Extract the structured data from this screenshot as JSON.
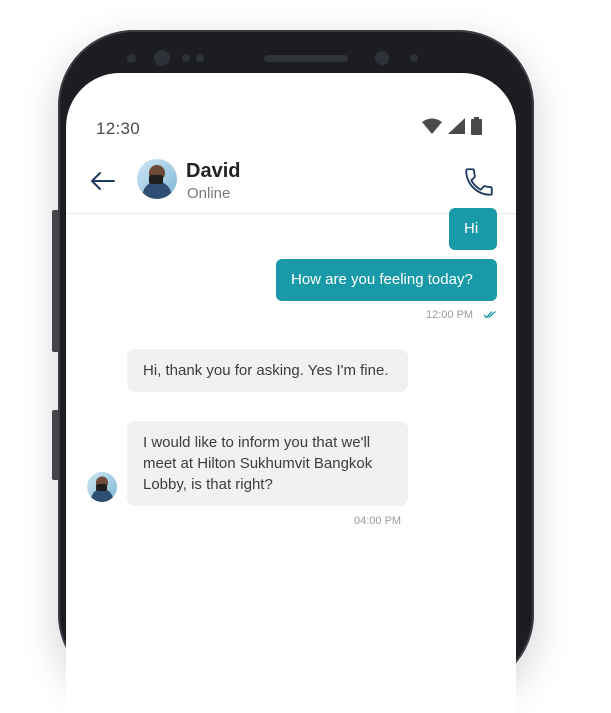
{
  "status_bar": {
    "time": "12:30",
    "icons": [
      "wifi-icon",
      "cellular-signal-icon",
      "battery-icon"
    ]
  },
  "header": {
    "contact_name": "David",
    "contact_status": "Online",
    "back_icon": "arrow-left-icon",
    "call_icon": "phone-icon"
  },
  "messages": {
    "outgoing": [
      {
        "text": "Hi"
      },
      {
        "text": "How are you feeling today?"
      }
    ],
    "outgoing_time": "12:00 PM",
    "outgoing_status_icon": "double-check-icon",
    "incoming": [
      {
        "text": "Hi, thank you for asking. Yes I'm fine."
      },
      {
        "text": "I would like to inform you that we'll meet at Hilton Sukhumvit Bangkok Lobby, is that right?"
      }
    ],
    "incoming_time": "04:00 PM"
  },
  "colors": {
    "accent": "#1a9aa8",
    "incoming_bubble": "#f1f1f1",
    "phone_frame": "#1b1d22",
    "icon_dark": "#1e3a5f"
  }
}
